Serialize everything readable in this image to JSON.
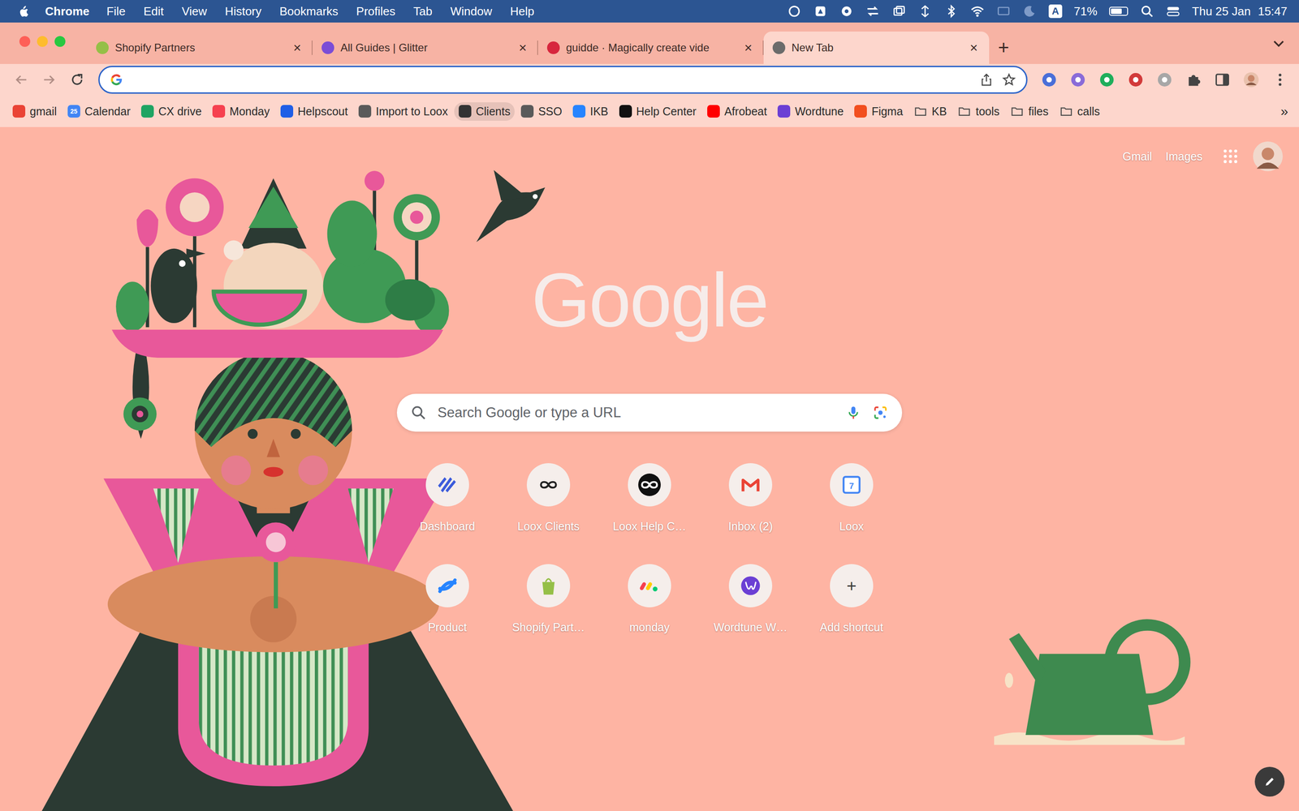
{
  "menubar": {
    "app": "Chrome",
    "menus": [
      "File",
      "Edit",
      "View",
      "History",
      "Bookmarks",
      "Profiles",
      "Tab",
      "Window",
      "Help"
    ],
    "input_source": "A",
    "battery": "71%",
    "battery_level": 0.71,
    "date": "Thu 25 Jan",
    "time": "15:47"
  },
  "tabs": [
    {
      "label": "Shopify Partners",
      "selected": false,
      "color": "#95bf47"
    },
    {
      "label": "All Guides | Glitter",
      "selected": false,
      "color": "#7b4dd6"
    },
    {
      "label": "guidde · Magically create vide",
      "selected": false,
      "color": "#d7263d"
    },
    {
      "label": "New Tab",
      "selected": true,
      "color": "#6b6b6b"
    }
  ],
  "tab_close": "×",
  "new_tab": "+",
  "navigation": [
    {
      "kind": "back",
      "disabled": true
    },
    {
      "kind": "forward",
      "disabled": true
    },
    {
      "kind": "reload",
      "disabled": false
    }
  ],
  "omnibox": {
    "value": "",
    "focused": true
  },
  "bookmarks": [
    {
      "label": "gmail",
      "kind": "site",
      "color": "#ea4335",
      "highlighted": false
    },
    {
      "label": "Calendar",
      "kind": "site",
      "color": "#4285f4",
      "icon_text": "25",
      "highlighted": false
    },
    {
      "label": "CX drive",
      "kind": "site",
      "color": "#1fa463",
      "highlighted": false
    },
    {
      "label": "Monday",
      "kind": "site",
      "color": "#f6404f",
      "highlighted": false
    },
    {
      "label": "Helpscout",
      "kind": "site",
      "color": "#1f5ee6",
      "highlighted": false
    },
    {
      "label": "Import to Loox",
      "kind": "site",
      "color": "#5a5a5a",
      "highlighted": false
    },
    {
      "label": "Clients",
      "kind": "site",
      "color": "#333333",
      "highlighted": true
    },
    {
      "label": "SSO",
      "kind": "site",
      "color": "#5a5a5a",
      "highlighted": false
    },
    {
      "label": "IKB",
      "kind": "site",
      "color": "#2684ff",
      "highlighted": false
    },
    {
      "label": "Help Center",
      "kind": "site",
      "color": "#111111",
      "highlighted": false
    },
    {
      "label": "Afrobeat",
      "kind": "site",
      "color": "#ff0000",
      "highlighted": false
    },
    {
      "label": "Wordtune",
      "kind": "site",
      "color": "#6b3fd4",
      "highlighted": false
    },
    {
      "label": "Figma",
      "kind": "site",
      "color": "#f24e1e",
      "highlighted": false
    },
    {
      "label": "KB",
      "kind": "folder",
      "highlighted": false
    },
    {
      "label": "tools",
      "kind": "folder",
      "highlighted": false
    },
    {
      "label": "files",
      "kind": "folder",
      "highlighted": false
    },
    {
      "label": "calls",
      "kind": "folder",
      "highlighted": false
    }
  ],
  "bookmarks_more": "»",
  "page": {
    "links": [
      "Gmail",
      "Images"
    ],
    "logo": "Google",
    "search_placeholder": "Search Google or type a URL",
    "shortcuts": [
      {
        "label": "Dashboard",
        "color": "#3b5bdb"
      },
      {
        "label": "Loox Clients",
        "color": "#222222"
      },
      {
        "label": "Loox Help C…",
        "color": "#111111"
      },
      {
        "label": "Inbox (2)",
        "color": "#ea4335"
      },
      {
        "label": "Loox",
        "color": "#4285f4",
        "icon_text": "7"
      },
      {
        "label": "Product",
        "color": "#2684ff"
      },
      {
        "label": "Shopify Part…",
        "color": "#95bf47"
      },
      {
        "label": "monday",
        "color": "#f6404f"
      },
      {
        "label": "Wordtune W…",
        "color": "#6b3fd4"
      },
      {
        "label": "Add shortcut",
        "color": "#3c3c3c",
        "icon_text": "+"
      }
    ]
  }
}
